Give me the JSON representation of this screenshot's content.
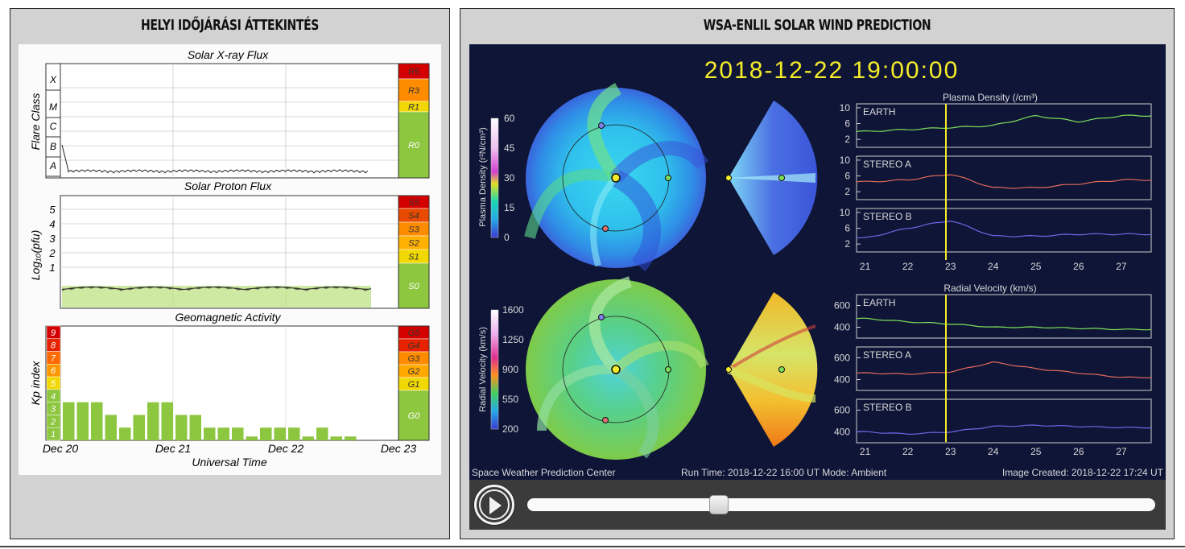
{
  "left_panel": {
    "title": "HELYI IDŐJÁRÁSI ÁTTEKINTÉS",
    "xray": {
      "title": "Solar X-ray Flux",
      "ylabel": "Flare Class",
      "classes": [
        "X",
        "M",
        "C",
        "B",
        "A"
      ],
      "scale": [
        "R5",
        "R3",
        "R1",
        "R0"
      ],
      "scale_colors": [
        "#d40000",
        "#ff8c00",
        "#f0d800",
        "#8dc63f"
      ]
    },
    "proton": {
      "title": "Solar Proton Flux",
      "ylabel": "Log₁₀(pfu)",
      "ticks": [
        "5",
        "4",
        "3",
        "2",
        "1"
      ],
      "scale": [
        "S5",
        "S4",
        "S3",
        "S2",
        "S1",
        "S0"
      ],
      "scale_colors": [
        "#d40000",
        "#e84a00",
        "#ff8c00",
        "#ffb000",
        "#f0d800",
        "#8dc63f"
      ]
    },
    "geomag": {
      "title": "Geomagnetic Activity",
      "ylabel": "Kp index",
      "kp_levels": [
        "9",
        "8",
        "7",
        "6",
        "5",
        "4",
        "3",
        "2",
        "1"
      ],
      "kp_colors": [
        "#d40000",
        "#e62200",
        "#ff6a00",
        "#ff9800",
        "#f0d800",
        "#8dc63f",
        "#8dc63f",
        "#8dc63f",
        "#8dc63f"
      ],
      "scale": [
        "G5",
        "G4",
        "G3",
        "G2",
        "G1",
        "G0"
      ],
      "scale_colors": [
        "#d40000",
        "#e62200",
        "#ff8c00",
        "#ffa800",
        "#f0d800",
        "#8dc63f"
      ]
    },
    "xaxis_ticks": [
      "Dec 20",
      "Dec 21",
      "Dec 22",
      "Dec 23"
    ],
    "xlabel": "Universal Time"
  },
  "right_panel": {
    "title": "WSA-ENLIL SOLAR WIND PREDICTION",
    "timestamp": "2018-12-22   19:00:00",
    "density_colorbar": {
      "label": "Plasma Density (r²N/cm³)",
      "ticks": [
        "60",
        "45",
        "30",
        "15",
        "0"
      ]
    },
    "velocity_colorbar": {
      "label": "Radial Velocity (km/s)",
      "ticks": [
        "1600",
        "1250",
        "900",
        "550",
        "200"
      ]
    },
    "density_plot_title": "Plasma Density (/cm³)",
    "velocity_plot_title": "Radial Velocity (km/s)",
    "density_ticks": [
      "10",
      "6",
      "2"
    ],
    "velocity_ticks": [
      "600",
      "400"
    ],
    "series_names": [
      "EARTH",
      "STEREO A",
      "STEREO B"
    ],
    "series_colors": [
      "#7de05a",
      "#e26a5a",
      "#6a6ae8"
    ],
    "x_ticks": [
      "21",
      "22",
      "23",
      "24",
      "25",
      "26",
      "27"
    ],
    "footer_left": "Space Weather Prediction Center",
    "footer_mid": "Run Time: 2018-12-22 16:00 UT   Mode: Ambient",
    "footer_right": "Image Created: 2018-12-22 17:24 UT"
  },
  "chart_data": [
    {
      "type": "bar",
      "title": "Geomagnetic Activity",
      "xlabel": "Universal Time",
      "ylabel": "Kp index",
      "ylim": [
        0,
        9
      ],
      "x_range": [
        "Dec 20",
        "Dec 23"
      ],
      "values": [
        3,
        3,
        3,
        2,
        1,
        2,
        3,
        3,
        2,
        2,
        1,
        1,
        1,
        0.3,
        1,
        1,
        1,
        0.3,
        1,
        0.3,
        0.3
      ]
    },
    {
      "type": "line",
      "title": "Plasma Density (/cm³)",
      "x": [
        21,
        22,
        23,
        24,
        25,
        26,
        27
      ],
      "series": [
        {
          "name": "EARTH",
          "values": [
            4,
            4.5,
            5,
            5.5,
            8,
            6.5,
            8
          ]
        },
        {
          "name": "STEREO A",
          "values": [
            4.5,
            5,
            6.5,
            3,
            3,
            4,
            5
          ]
        },
        {
          "name": "STEREO B",
          "values": [
            3.5,
            6,
            8,
            4,
            4,
            4.5,
            4.5
          ]
        }
      ]
    },
    {
      "type": "line",
      "title": "Radial Velocity (km/s)",
      "x": [
        21,
        22,
        23,
        24,
        25,
        26,
        27
      ],
      "series": [
        {
          "name": "EARTH",
          "values": [
            480,
            450,
            430,
            400,
            400,
            390,
            380
          ]
        },
        {
          "name": "STEREO A",
          "values": [
            460,
            450,
            470,
            560,
            500,
            460,
            420
          ]
        },
        {
          "name": "STEREO B",
          "values": [
            400,
            380,
            400,
            450,
            460,
            450,
            440
          ]
        }
      ]
    }
  ]
}
